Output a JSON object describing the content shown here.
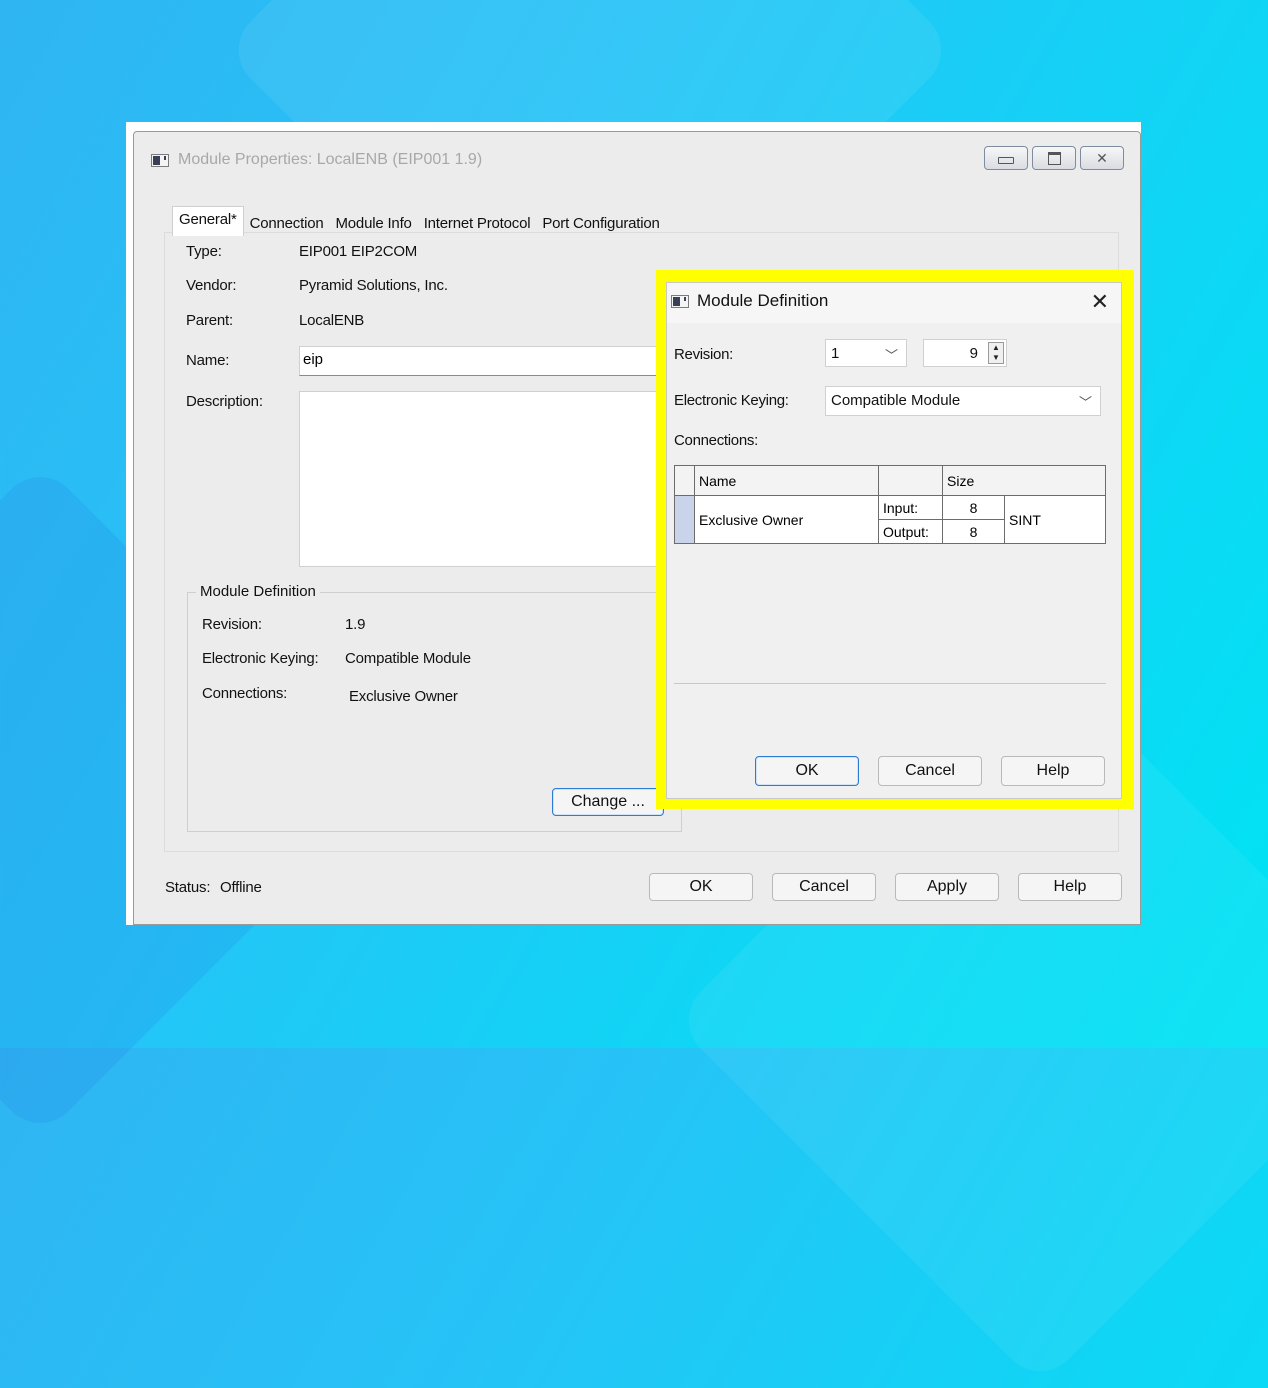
{
  "window": {
    "title": "Module Properties: LocalENB (EIP001 1.9)",
    "icons": [
      "app-icon",
      "minimize-icon",
      "maximize-icon",
      "close-icon"
    ]
  },
  "tabs": [
    {
      "label": "General*"
    },
    {
      "label": "Connection"
    },
    {
      "label": "Module Info"
    },
    {
      "label": "Internet Protocol"
    },
    {
      "label": "Port Configuration"
    }
  ],
  "general": {
    "type_label": "Type:",
    "type_value": "EIP001 EIP2COM",
    "vendor_label": "Vendor:",
    "vendor_value": "Pyramid Solutions, Inc.",
    "parent_label": "Parent:",
    "parent_value": "LocalENB",
    "name_label": "Name:",
    "name_value": "eip",
    "description_label": "Description:",
    "description_value": ""
  },
  "module_definition": {
    "group_title": "Module Definition",
    "revision_label": "Revision:",
    "revision_value": "1.9",
    "keying_label": "Electronic Keying:",
    "keying_value": "Compatible Module",
    "connections_label": "Connections:",
    "connections_value": "Exclusive Owner",
    "change_button": "Change ..."
  },
  "footer": {
    "status_label": "Status:",
    "status_value": "Offline",
    "ok": "OK",
    "cancel": "Cancel",
    "apply": "Apply",
    "help": "Help"
  },
  "dialog": {
    "title": "Module Definition",
    "close_glyph": "✕",
    "revision_label": "Revision:",
    "revision_major": "1",
    "revision_minor": "9",
    "keying_label": "Electronic Keying:",
    "keying_value": "Compatible Module",
    "connections_label": "Connections:",
    "table": {
      "headers": [
        "Name",
        "",
        "Size"
      ],
      "row": {
        "name": "Exclusive Owner",
        "input_label": "Input:",
        "input_size": "8",
        "output_label": "Output:",
        "output_size": "8",
        "type": "SINT"
      }
    },
    "ok": "OK",
    "cancel": "Cancel",
    "help": "Help",
    "highlight_color": "#ffff00"
  }
}
